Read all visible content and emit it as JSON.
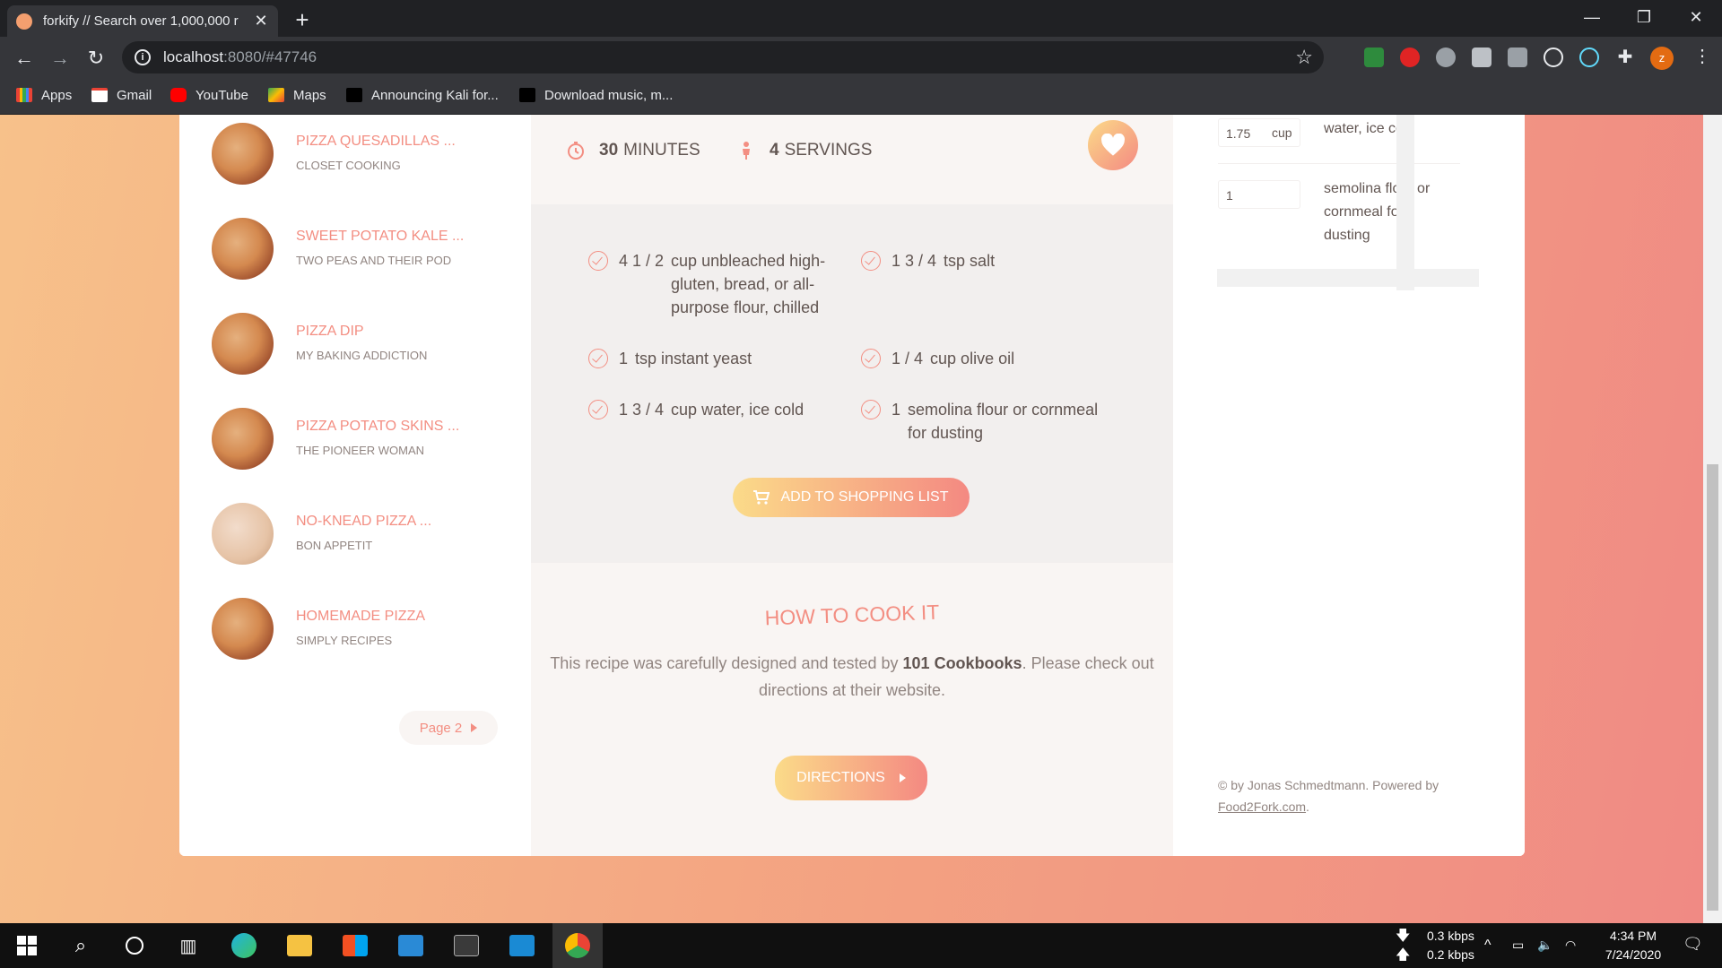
{
  "browser": {
    "tab_title": "forkify // Search over 1,000,000 r",
    "tab_close": "✕",
    "new_tab": "+",
    "url_host": "localhost",
    "url_rest": ":8080/#47746",
    "bookmarks": [
      "Apps",
      "Gmail",
      "YouTube",
      "Maps",
      "Announcing Kali for...",
      "Download music, m..."
    ],
    "profile_initial": "z",
    "window_controls": [
      "—",
      "❐",
      "✕"
    ]
  },
  "results": {
    "items": [
      {
        "name": "PIZZA QUESADILLAS ...",
        "publisher": "CLOSET COOKING"
      },
      {
        "name": "SWEET POTATO KALE ...",
        "publisher": "TWO PEAS AND THEIR POD"
      },
      {
        "name": "PIZZA DIP",
        "publisher": "MY BAKING ADDICTION"
      },
      {
        "name": "PIZZA POTATO SKINS ...",
        "publisher": "THE PIONEER WOMAN"
      },
      {
        "name": "NO-KNEAD PIZZA ...",
        "publisher": "BON APPETIT"
      },
      {
        "name": "HOMEMADE PIZZA",
        "publisher": "SIMPLY RECIPES"
      }
    ],
    "page_button": "Page 2"
  },
  "recipe": {
    "time": "30",
    "time_unit": "MINUTES",
    "servings": "4",
    "servings_unit": "SERVINGS",
    "ingredients": [
      {
        "count": "4 1 / 2",
        "text": "cup unbleached high-gluten, bread, or all-purpose flour, chilled"
      },
      {
        "count": "1 3 / 4",
        "text": "tsp salt"
      },
      {
        "count": "1",
        "text": "tsp instant yeast"
      },
      {
        "count": "1 / 4",
        "text": "cup olive oil"
      },
      {
        "count": "1 3 / 4",
        "text": "cup water, ice cold"
      },
      {
        "count": "1",
        "text": "semolina flour or cornmeal for dusting"
      }
    ],
    "add_to_list": "ADD TO SHOPPING LIST",
    "howto_title": "HOW TO COOK IT",
    "howto_text_1": "This recipe was carefully designed and tested by ",
    "howto_publisher": "101 Cookbooks",
    "howto_text_2": ". Please check out directions at their website.",
    "directions_button": "DIRECTIONS"
  },
  "shopping": {
    "items": [
      {
        "qty": "1.75",
        "unit": "cup",
        "desc": "water, ice cold"
      },
      {
        "qty": "1",
        "unit": "",
        "desc": "semolina flour or cornmeal for dusting"
      }
    ],
    "copyright_text": "© by Jonas Schmedtmann. Powered by ",
    "copyright_link": "Food2Fork.com",
    "copyright_end": "."
  },
  "taskbar": {
    "net_down": "0.3 kbps",
    "net_up": "0.2 kbps",
    "time": "4:34 PM",
    "date": "7/24/2020"
  },
  "colors": {
    "accent": "#f38e82",
    "gradient_start": "#fbdb89",
    "gradient_end": "#f48982",
    "text": "#615551"
  }
}
